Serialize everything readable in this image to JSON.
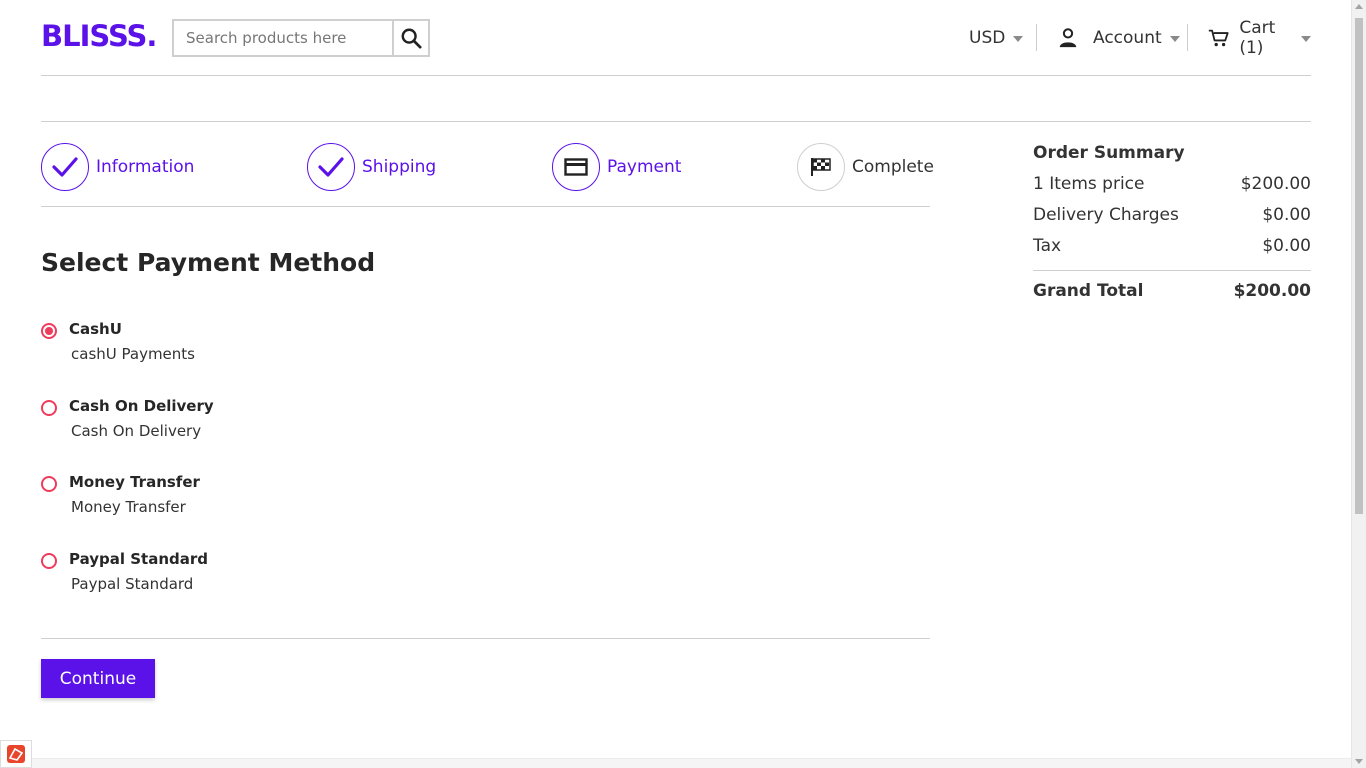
{
  "header": {
    "logo": "BLISSS.",
    "search_placeholder": "Search products here",
    "currency": "USD",
    "account_label": "Account",
    "cart_label": "Cart (1)"
  },
  "steps": [
    {
      "label": "Information",
      "icon": "check-icon",
      "state": "done"
    },
    {
      "label": "Shipping",
      "icon": "check-icon",
      "state": "done"
    },
    {
      "label": "Payment",
      "icon": "card-icon",
      "state": "active"
    },
    {
      "label": "Complete",
      "icon": "checkered-flag-icon",
      "state": "pending"
    }
  ],
  "payment": {
    "title": "Select Payment Method",
    "methods": [
      {
        "title": "CashU",
        "description": "cashU Payments",
        "selected": true
      },
      {
        "title": "Cash On Delivery",
        "description": "Cash On Delivery",
        "selected": false
      },
      {
        "title": "Money Transfer",
        "description": "Money Transfer",
        "selected": false
      },
      {
        "title": "Paypal Standard",
        "description": "Paypal Standard",
        "selected": false
      }
    ],
    "continue_label": "Continue"
  },
  "summary": {
    "title": "Order Summary",
    "rows": [
      {
        "label": "1 Items price",
        "value": "$200.00"
      },
      {
        "label": "Delivery Charges",
        "value": "$0.00"
      },
      {
        "label": "Tax",
        "value": "$0.00"
      }
    ],
    "total_label": "Grand Total",
    "total_value": "$200.00"
  },
  "colors": {
    "brand": "#5b12e8",
    "radio": "#ef3b5c",
    "text": "#333333",
    "divider": "#cfcfcf"
  }
}
